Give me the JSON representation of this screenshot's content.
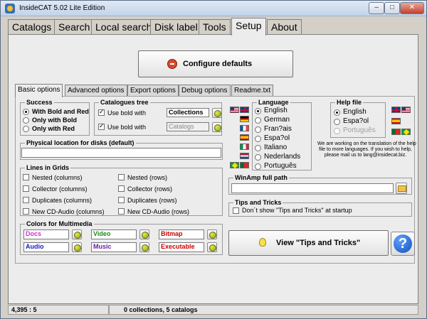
{
  "window": {
    "title": "InsideCAT 5.02 Lite Edition",
    "minimize": "–",
    "maximize": "□",
    "close": "✕"
  },
  "main_tabs": [
    "Catalogs",
    "Search",
    "Local search",
    "Disk label",
    "Tools",
    "Setup",
    "About"
  ],
  "active_main_tab": "Setup",
  "configure_defaults": "Configure defaults",
  "sub_tabs": [
    "Basic options",
    "Advanced options",
    "Export options",
    "Debug options",
    "Readme.txt"
  ],
  "active_sub_tab": "Basic options",
  "success": {
    "title": "Success",
    "options": [
      "With Bold and Red",
      "Only with Bold",
      "Only with Red"
    ],
    "selected": "With Bold and Red"
  },
  "catalogues_tree": {
    "title": "Catalogues tree",
    "rows": [
      {
        "label": "Use bold with",
        "value": "Collections",
        "checked": true
      },
      {
        "label": "Use bold with",
        "value": "Catalogs",
        "checked": true
      }
    ]
  },
  "physical_location": {
    "title": "Physical location for disks (default)",
    "value": ""
  },
  "lines_in_grids": {
    "title": "Lines in Grids",
    "left": [
      "Nested (columns)",
      "Collector (columns)",
      "Duplicates (columns)",
      "New CD-Audio (columns)"
    ],
    "right": [
      "Nested (rows)",
      "Collector (rows)",
      "Duplicates (rows)",
      "New CD-Audio (rows)"
    ]
  },
  "colors_multimedia": {
    "title": "Colors for Multimedia",
    "items": [
      {
        "label": "Docs",
        "color": "#d22fd2"
      },
      {
        "label": "Video",
        "color": "#1a8a1a"
      },
      {
        "label": "Bitmap",
        "color": "#cc0000"
      },
      {
        "label": "Audio",
        "color": "#1818c8"
      },
      {
        "label": "Music",
        "color": "#6a1aa8"
      },
      {
        "label": "Executable",
        "color": "#cc0000"
      }
    ]
  },
  "language": {
    "title": "Language",
    "options": [
      "English",
      "German",
      "Fran?ais",
      "Espa?ol",
      "Italiano",
      "Nederlands",
      "Português"
    ],
    "selected": "English"
  },
  "help_file": {
    "title": "Help file",
    "options": [
      "English",
      "Espa?ol",
      "Português"
    ],
    "selected": "English",
    "note": [
      "We are working on the translation of the help",
      "file to more languages. If you wish to help,",
      "please mail us to lang@insidecat.biz."
    ]
  },
  "winamp": {
    "title": "WinAmp full path",
    "value": ""
  },
  "tips": {
    "title": "Tips and Tricks",
    "checkbox_label": "Don´t show \"Tips and Tricks\" at startup"
  },
  "view_tips": "View \"Tips and Tricks\"",
  "help_button": "?",
  "status": {
    "coords": "4,395 : 5",
    "summary": "0 collections, 5 catalogs"
  },
  "icons": [
    "app-icon",
    "configure-icon",
    "palette-icon",
    "folder-icon",
    "bulb-icon",
    "help-icon"
  ]
}
